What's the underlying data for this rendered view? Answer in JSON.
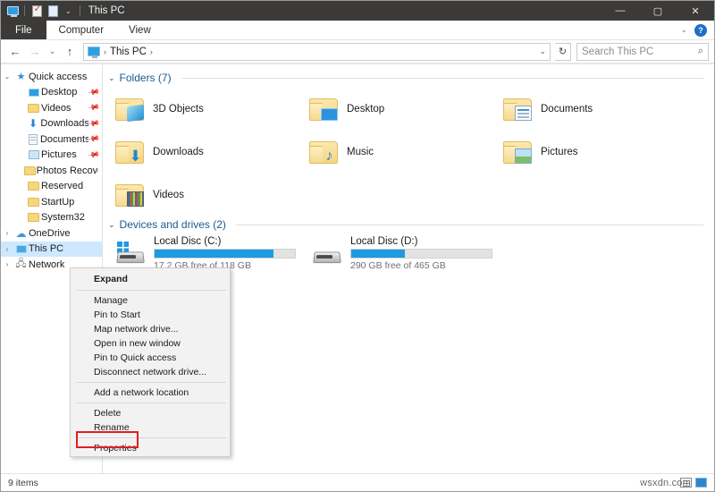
{
  "titlebar": {
    "title": "This PC",
    "quick_access": [
      {
        "name": "this-pc-icon",
        "label": "This PC"
      },
      {
        "name": "properties-icon",
        "label": "Properties"
      },
      {
        "name": "new-folder-icon",
        "label": "New folder"
      }
    ],
    "customize_caret": "⌄",
    "minimize": "—",
    "maximize": "▢",
    "close": "✕"
  },
  "ribbon": {
    "file_tab": "File",
    "tabs": [
      "Computer",
      "View"
    ],
    "collapse_caret": "⌄",
    "help": "?"
  },
  "address": {
    "back": "←",
    "forward": "→",
    "recent_caret": "⌄",
    "up": "↑",
    "path_segments": [
      "This PC"
    ],
    "chevron": "›",
    "dropdown_caret": "⌄",
    "refresh": "↻",
    "search_placeholder": "Search This PC",
    "search_icon": "⌕"
  },
  "sidebar": {
    "items": [
      {
        "label": "Quick access",
        "icon": "star-icon",
        "expander": "⌄",
        "indent": 0,
        "pinned": false,
        "selected": false
      },
      {
        "label": "Desktop",
        "icon": "desktop-icon",
        "expander": "",
        "indent": 1,
        "pinned": true,
        "selected": false
      },
      {
        "label": "Videos",
        "icon": "folder-icon",
        "expander": "",
        "indent": 1,
        "pinned": true,
        "selected": false
      },
      {
        "label": "Downloads",
        "icon": "download-icon",
        "expander": "",
        "indent": 1,
        "pinned": true,
        "selected": false
      },
      {
        "label": "Documents",
        "icon": "document-icon",
        "expander": "",
        "indent": 1,
        "pinned": true,
        "selected": false
      },
      {
        "label": "Pictures",
        "icon": "picture-icon",
        "expander": "",
        "indent": 1,
        "pinned": true,
        "selected": false
      },
      {
        "label": "Photos Recovery",
        "icon": "folder-icon",
        "expander": "",
        "indent": 1,
        "pinned": false,
        "selected": false
      },
      {
        "label": "Reserved",
        "icon": "folder-icon",
        "expander": "",
        "indent": 1,
        "pinned": false,
        "selected": false
      },
      {
        "label": "StartUp",
        "icon": "folder-icon",
        "expander": "",
        "indent": 1,
        "pinned": false,
        "selected": false
      },
      {
        "label": "System32",
        "icon": "folder-icon",
        "expander": "",
        "indent": 1,
        "pinned": false,
        "selected": false
      },
      {
        "label": "OneDrive",
        "icon": "cloud-icon",
        "expander": "›",
        "indent": 0,
        "pinned": false,
        "selected": false
      },
      {
        "label": "This PC",
        "icon": "this-pc-icon",
        "expander": "›",
        "indent": 0,
        "pinned": false,
        "selected": true
      },
      {
        "label": "Network",
        "icon": "network-icon",
        "expander": "›",
        "indent": 0,
        "pinned": false,
        "selected": false
      }
    ]
  },
  "content": {
    "folders_group": {
      "caret": "⌄",
      "title": "Folders (7)",
      "items": [
        {
          "label": "3D Objects",
          "icon": "folder-3d-objects-icon"
        },
        {
          "label": "Desktop",
          "icon": "folder-desktop-icon"
        },
        {
          "label": "Documents",
          "icon": "folder-documents-icon"
        },
        {
          "label": "Downloads",
          "icon": "folder-downloads-icon"
        },
        {
          "label": "Music",
          "icon": "folder-music-icon"
        },
        {
          "label": "Pictures",
          "icon": "folder-pictures-icon"
        },
        {
          "label": "Videos",
          "icon": "folder-videos-icon"
        }
      ]
    },
    "drives_group": {
      "caret": "⌄",
      "title": "Devices and drives (2)",
      "items": [
        {
          "name": "Local Disc (C:)",
          "free": "17.2 GB free of 118 GB",
          "used_percent": 85,
          "system": true
        },
        {
          "name": "Local Disc (D:)",
          "free": "290 GB free of 465 GB",
          "used_percent": 38,
          "system": false
        }
      ]
    }
  },
  "context_menu": {
    "items": [
      {
        "label": "Expand",
        "bold": true,
        "separator_after": true,
        "highlighted": false
      },
      {
        "label": "Manage",
        "bold": false,
        "separator_after": false,
        "highlighted": false
      },
      {
        "label": "Pin to Start",
        "bold": false,
        "separator_after": false,
        "highlighted": false
      },
      {
        "label": "Map network drive...",
        "bold": false,
        "separator_after": false,
        "highlighted": false
      },
      {
        "label": "Open in new window",
        "bold": false,
        "separator_after": false,
        "highlighted": false
      },
      {
        "label": "Pin to Quick access",
        "bold": false,
        "separator_after": false,
        "highlighted": false
      },
      {
        "label": "Disconnect network drive...",
        "bold": false,
        "separator_after": true,
        "highlighted": false
      },
      {
        "label": "Add a network location",
        "bold": false,
        "separator_after": true,
        "highlighted": false
      },
      {
        "label": "Delete",
        "bold": false,
        "separator_after": false,
        "highlighted": false
      },
      {
        "label": "Rename",
        "bold": false,
        "separator_after": true,
        "highlighted": false
      },
      {
        "label": "Properties",
        "bold": false,
        "separator_after": false,
        "highlighted": true
      }
    ]
  },
  "statusbar": {
    "item_count": "9 items",
    "view_list_icon": "list-view-icon",
    "view_tile_icon": "tile-view-icon"
  },
  "watermark": "wsxdn.com",
  "colors": {
    "accent": "#1e9ae0",
    "titlebar": "#3b3a39",
    "selection": "#cde8ff",
    "group_title": "#1b5a8f",
    "highlight_box": "#e02020"
  }
}
